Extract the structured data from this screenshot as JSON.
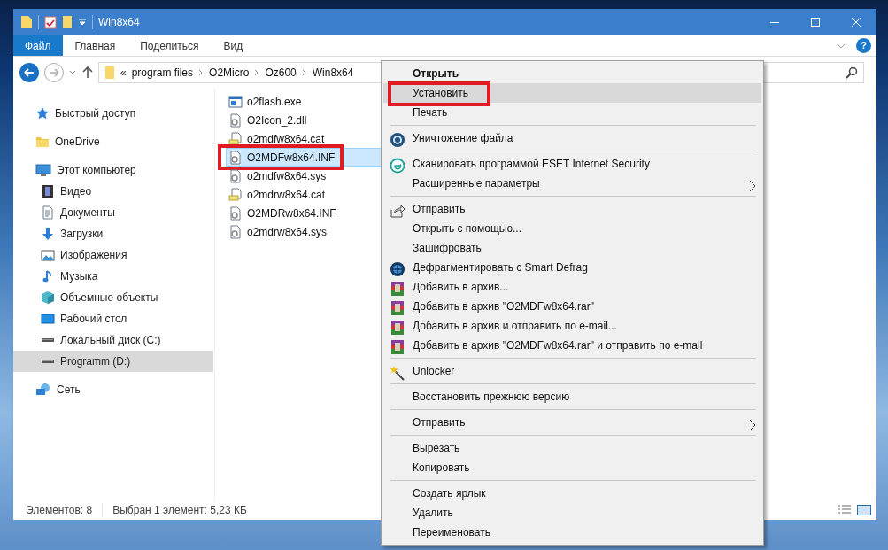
{
  "window": {
    "title": "Win8x64"
  },
  "ribbon": {
    "tabs": [
      {
        "label": "Файл",
        "selected": true
      },
      {
        "label": "Главная",
        "selected": false
      },
      {
        "label": "Поделиться",
        "selected": false
      },
      {
        "label": "Вид",
        "selected": false
      }
    ],
    "help": "?"
  },
  "address_bar": {
    "overflow": "«",
    "crumbs": [
      "program files",
      "O2Micro",
      "Oz600",
      "Win8x64"
    ]
  },
  "sidebar": {
    "items": [
      {
        "label": "Быстрый доступ",
        "selected": false
      },
      {
        "label": "OneDrive",
        "selected": false
      },
      {
        "label": "Этот компьютер",
        "selected": false,
        "children": [
          {
            "label": "Видео",
            "selected": false
          },
          {
            "label": "Документы",
            "selected": false
          },
          {
            "label": "Загрузки",
            "selected": false
          },
          {
            "label": "Изображения",
            "selected": false
          },
          {
            "label": "Музыка",
            "selected": false
          },
          {
            "label": "Объемные объекты",
            "selected": false
          },
          {
            "label": "Рабочий стол",
            "selected": false
          },
          {
            "label": "Локальный диск (C:)",
            "selected": false
          },
          {
            "label": "Programm (D:)",
            "selected": true
          }
        ]
      },
      {
        "label": "Сеть",
        "selected": false
      }
    ]
  },
  "files": [
    {
      "name": "o2flash.exe",
      "selected": false,
      "framed": false
    },
    {
      "name": "O2Icon_2.dll",
      "selected": false,
      "framed": false
    },
    {
      "name": "o2mdfw8x64.cat",
      "selected": false,
      "framed": false
    },
    {
      "name": "O2MDFw8x64.INF",
      "selected": true,
      "framed": true
    },
    {
      "name": "o2mdfw8x64.sys",
      "selected": false,
      "framed": false
    },
    {
      "name": "o2mdrw8x64.cat",
      "selected": false,
      "framed": false
    },
    {
      "name": "O2MDRw8x64.INF",
      "selected": false,
      "framed": false
    },
    {
      "name": "o2mdrw8x64.sys",
      "selected": false,
      "framed": false
    }
  ],
  "status_bar": {
    "item_count": "Элементов: 8",
    "selection": "Выбран 1 элемент: 5,23 КБ"
  },
  "context_menu": {
    "items": [
      {
        "kind": "item",
        "label": "Открыть",
        "bold": true,
        "selected": false,
        "submenu": false,
        "framed": false
      },
      {
        "kind": "item",
        "label": "Установить",
        "selected": true,
        "submenu": false,
        "framed": true
      },
      {
        "kind": "item",
        "label": "Печать",
        "selected": false,
        "submenu": false,
        "framed": false
      },
      {
        "kind": "separator"
      },
      {
        "kind": "item",
        "label": "Уничтожение файла",
        "selected": false,
        "submenu": false,
        "framed": false
      },
      {
        "kind": "separator"
      },
      {
        "kind": "item",
        "label": "Сканировать программой ESET Internet Security",
        "selected": false,
        "submenu": false,
        "framed": false
      },
      {
        "kind": "item",
        "label": "Расширенные параметры",
        "selected": false,
        "submenu": true,
        "framed": false
      },
      {
        "kind": "separator"
      },
      {
        "kind": "item",
        "label": "Отправить",
        "selected": false,
        "submenu": false,
        "framed": false
      },
      {
        "kind": "item",
        "label": "Открыть с помощью...",
        "selected": false,
        "submenu": false,
        "framed": false
      },
      {
        "kind": "item",
        "label": "Зашифровать",
        "selected": false,
        "submenu": false,
        "framed": false
      },
      {
        "kind": "item",
        "label": "Дефрагментировать с Smart Defrag",
        "selected": false,
        "submenu": false,
        "framed": false
      },
      {
        "kind": "item",
        "label": "Добавить в архив...",
        "selected": false,
        "submenu": false,
        "framed": false
      },
      {
        "kind": "item",
        "label": "Добавить в архив \"O2MDFw8x64.rar\"",
        "selected": false,
        "submenu": false,
        "framed": false
      },
      {
        "kind": "item",
        "label": "Добавить в архив и отправить по e-mail...",
        "selected": false,
        "submenu": false,
        "framed": false
      },
      {
        "kind": "item",
        "label": "Добавить в архив \"O2MDFw8x64.rar\" и отправить по e-mail",
        "selected": false,
        "submenu": false,
        "framed": false
      },
      {
        "kind": "separator"
      },
      {
        "kind": "item",
        "label": "Unlocker",
        "selected": false,
        "submenu": false,
        "framed": false
      },
      {
        "kind": "separator"
      },
      {
        "kind": "item",
        "label": "Восстановить прежнюю версию",
        "selected": false,
        "submenu": false,
        "framed": false
      },
      {
        "kind": "separator"
      },
      {
        "kind": "item",
        "label": "Отправить",
        "selected": false,
        "submenu": true,
        "framed": false
      },
      {
        "kind": "separator"
      },
      {
        "kind": "item",
        "label": "Вырезать",
        "selected": false,
        "submenu": false,
        "framed": false
      },
      {
        "kind": "item",
        "label": "Копировать",
        "selected": false,
        "submenu": false,
        "framed": false
      },
      {
        "kind": "separator"
      },
      {
        "kind": "item",
        "label": "Создать ярлык",
        "selected": false,
        "submenu": false,
        "framed": false
      },
      {
        "kind": "item",
        "label": "Удалить",
        "selected": false,
        "submenu": false,
        "framed": false
      },
      {
        "kind": "item",
        "label": "Переименовать",
        "selected": false,
        "submenu": false,
        "framed": false
      }
    ]
  }
}
